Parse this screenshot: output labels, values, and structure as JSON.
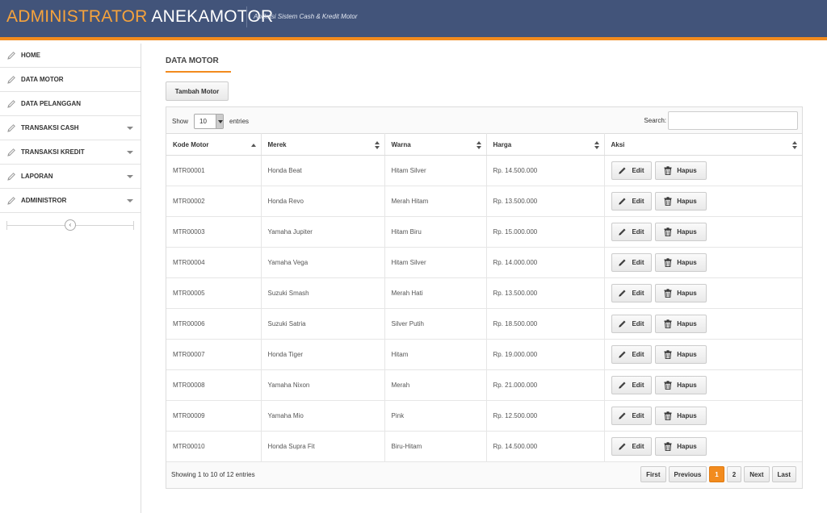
{
  "header": {
    "brand_part1": "ADMINISTRATOR",
    "brand_part2": "ANEKAMOTOR",
    "tagline": "Aplikasi Sistem Cash & Kredit Motor",
    "bg_color": "#42547a",
    "accent_color": "#f28b1e"
  },
  "sidebar": {
    "items": [
      {
        "label": "HOME",
        "icon": "pencil-icon",
        "has_submenu": false
      },
      {
        "label": "DATA MOTOR",
        "icon": "pencil-icon",
        "has_submenu": false
      },
      {
        "label": "DATA PELANGGAN",
        "icon": "pencil-icon",
        "has_submenu": false
      },
      {
        "label": "TRANSAKSI CASH",
        "icon": "pencil-icon",
        "has_submenu": true
      },
      {
        "label": "TRANSAKSI KREDIT",
        "icon": "pencil-icon",
        "has_submenu": true
      },
      {
        "label": "LAPORAN",
        "icon": "pencil-icon",
        "has_submenu": true
      },
      {
        "label": "ADMINISTROR",
        "icon": "pencil-icon",
        "has_submenu": true
      }
    ],
    "collapse_icon": "chevron-left-icon"
  },
  "main": {
    "title": "DATA MOTOR",
    "add_button": "Tambah Motor",
    "show_label": "Show",
    "entries_value": "10",
    "entries_label": "entries",
    "search_label": "Search:",
    "search_value": "",
    "columns": [
      "Kode Motor",
      "Merek",
      "Warna",
      "Harga",
      "Aksi"
    ],
    "sorted_column": "Kode Motor",
    "rows": [
      {
        "kode": "MTR00001",
        "merek": "Honda Beat",
        "warna": "Hitam Silver",
        "harga": "Rp. 14.500.000"
      },
      {
        "kode": "MTR00002",
        "merek": "Honda Revo",
        "warna": "Merah Hitam",
        "harga": "Rp. 13.500.000"
      },
      {
        "kode": "MTR00003",
        "merek": "Yamaha Jupiter",
        "warna": "Hitam Biru",
        "harga": "Rp. 15.000.000"
      },
      {
        "kode": "MTR00004",
        "merek": "Yamaha Vega",
        "warna": "Hitam Silver",
        "harga": "Rp. 14.000.000"
      },
      {
        "kode": "MTR00005",
        "merek": "Suzuki Smash",
        "warna": "Merah Hati",
        "harga": "Rp. 13.500.000"
      },
      {
        "kode": "MTR00006",
        "merek": "Suzuki Satria",
        "warna": "Silver Putih",
        "harga": "Rp. 18.500.000"
      },
      {
        "kode": "MTR00007",
        "merek": "Honda Tiger",
        "warna": "Hitam",
        "harga": "Rp. 19.000.000"
      },
      {
        "kode": "MTR00008",
        "merek": "Yamaha Nixon",
        "warna": "Merah",
        "harga": "Rp. 21.000.000"
      },
      {
        "kode": "MTR00009",
        "merek": "Yamaha Mio",
        "warna": "Pink",
        "harga": "Rp. 12.500.000"
      },
      {
        "kode": "MTR00010",
        "merek": "Honda Supra Fit",
        "warna": "Biru-Hitam",
        "harga": "Rp. 14.500.000"
      }
    ],
    "edit_label": "Edit",
    "delete_label": "Hapus",
    "info": "Showing 1 to 10 of 12 entries",
    "pagination": {
      "first": "First",
      "previous": "Previous",
      "pages": [
        "1",
        "2"
      ],
      "current": "1",
      "next": "Next",
      "last": "Last"
    }
  }
}
